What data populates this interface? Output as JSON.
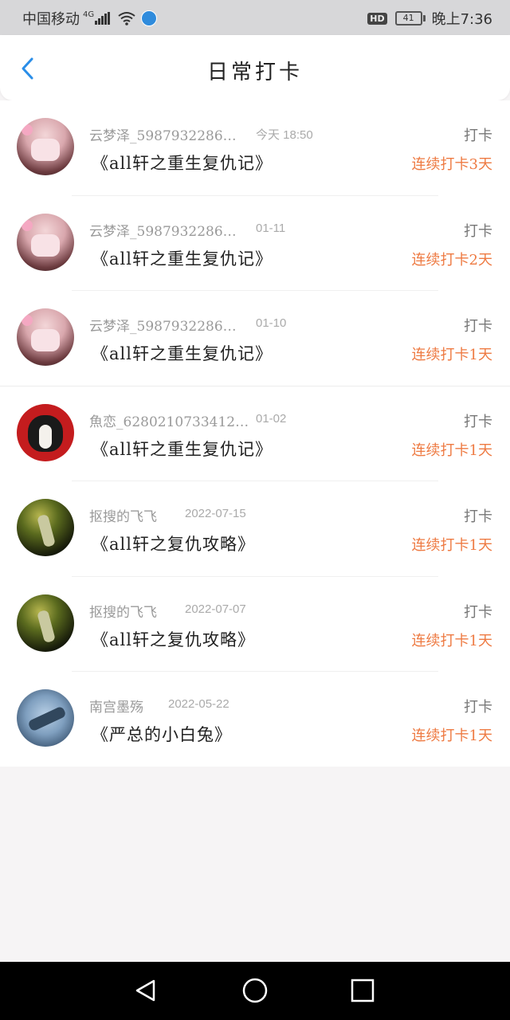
{
  "status_bar": {
    "carrier": "中国移动",
    "network": "4G",
    "hd": "HD",
    "battery": "41",
    "time": "晚上7:36"
  },
  "header": {
    "title": "日常打卡"
  },
  "checkins": [
    {
      "avatar": "girl",
      "username": "云梦泽_5987932286…",
      "date": "今天  18:50",
      "book": "《all轩之重生复仇记》",
      "action": "打卡",
      "streak": "连续打卡3天"
    },
    {
      "avatar": "girl",
      "username": "云梦泽_5987932286…",
      "date": "01-11",
      "book": "《all轩之重生复仇记》",
      "action": "打卡",
      "streak": "连续打卡2天"
    },
    {
      "avatar": "girl",
      "username": "云梦泽_5987932286…",
      "date": "01-10",
      "book": "《all轩之重生复仇记》",
      "action": "打卡",
      "streak": "连续打卡1天"
    },
    {
      "avatar": "dog",
      "username": "魚恋_6280210733412…",
      "date": "01-02",
      "book": "《all轩之重生复仇记》",
      "action": "打卡",
      "streak": "连续打卡1天"
    },
    {
      "avatar": "dark",
      "username": "抠搜的飞飞",
      "date": "2022-07-15",
      "book": "《all轩之复仇攻略》",
      "action": "打卡",
      "streak": "连续打卡1天"
    },
    {
      "avatar": "dark",
      "username": "抠搜的飞飞",
      "date": "2022-07-07",
      "book": "《all轩之复仇攻略》",
      "action": "打卡",
      "streak": "连续打卡1天"
    },
    {
      "avatar": "blue",
      "username": "南宫墨殇",
      "date": "2022-05-22",
      "book": "《严总的小白兔》",
      "action": "打卡",
      "streak": "连续打卡1天"
    }
  ],
  "nav_bar": {
    "icons": [
      "back-triangle-icon",
      "home-circle-icon",
      "recents-square-icon"
    ]
  },
  "colors": {
    "accent_blue": "#2a8ee8",
    "streak_orange": "#ee7a42",
    "status_bar_bg": "#d7d7d9",
    "page_bg": "#f6f4f5"
  }
}
